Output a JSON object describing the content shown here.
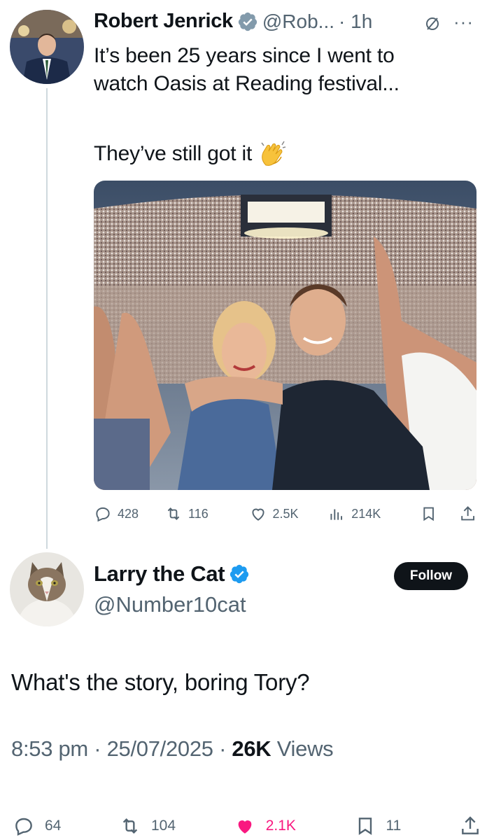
{
  "original_tweet": {
    "author_name": "Robert Jenrick",
    "handle": "@Rob...",
    "time": "· 1h",
    "text_line1": "It’s been 25 years since I went to",
    "text_line2": "watch Oasis at Reading festival...",
    "text_line3": "They’ve still got it",
    "emoji": "clapping-hands-emoji",
    "actions": {
      "replies": "428",
      "retweets": "116",
      "likes": "2.5K",
      "views": "214K"
    }
  },
  "reply": {
    "author_name": "Larry the Cat",
    "handle": "@Number10cat",
    "follow_label": "Follow",
    "text": "What's the story, boring Tory?",
    "time": "8:53 pm",
    "date": "25/07/2025",
    "views_count": "26K",
    "views_label": "Views",
    "actions": {
      "replies": "64",
      "retweets": "104",
      "likes": "2.1K",
      "bookmarks": "11"
    }
  },
  "colors": {
    "verified": "#1d9bf0",
    "text": "#0f1419",
    "muted": "#536471",
    "like_active": "#f91880",
    "thread_line": "#cfd9de"
  }
}
